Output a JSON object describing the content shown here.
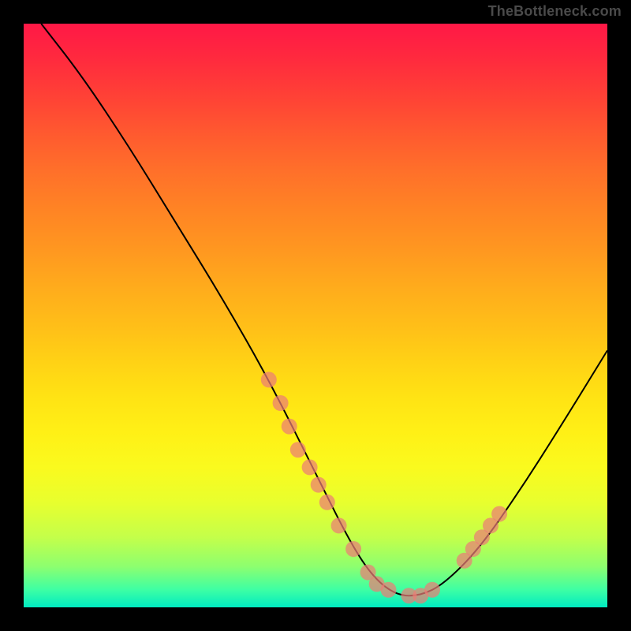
{
  "watermark": "TheBottleneck.com",
  "chart_data": {
    "type": "line",
    "title": "",
    "xlabel": "",
    "ylabel": "",
    "x": [
      0.03,
      0.1,
      0.18,
      0.26,
      0.34,
      0.42,
      0.5,
      0.56,
      0.6,
      0.64,
      0.68,
      0.72,
      0.78,
      0.85,
      0.92,
      1.0
    ],
    "values": [
      100,
      91,
      79,
      66,
      53,
      39,
      23,
      11,
      5,
      2,
      2,
      4,
      10,
      20,
      31,
      44
    ],
    "xlim": [
      0,
      1
    ],
    "ylim": [
      0,
      100
    ],
    "markers": {
      "x": [
        0.42,
        0.44,
        0.455,
        0.47,
        0.49,
        0.505,
        0.52,
        0.54,
        0.565,
        0.59,
        0.605,
        0.625,
        0.66,
        0.68,
        0.7,
        0.755,
        0.77,
        0.785,
        0.8,
        0.815
      ],
      "y": [
        39,
        35,
        31,
        27,
        24,
        21,
        18,
        14,
        10,
        6,
        4,
        3,
        2,
        2,
        3,
        8,
        10,
        12,
        14,
        16
      ]
    },
    "background": "red-yellow-green vertical gradient",
    "legend": false
  }
}
